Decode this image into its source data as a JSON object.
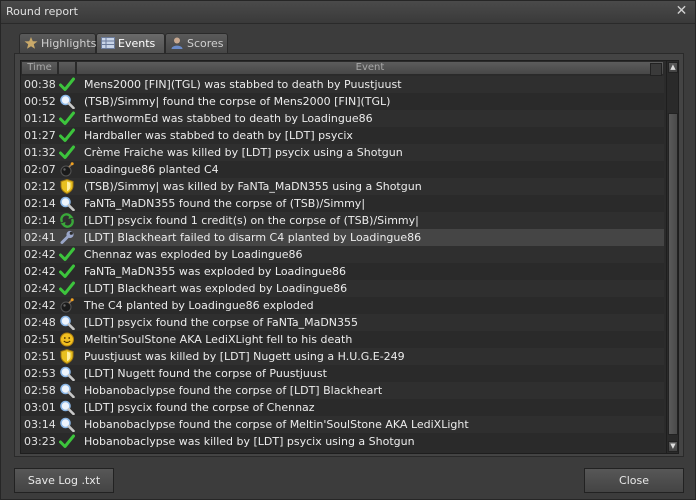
{
  "window": {
    "title": "Round report",
    "close_symbol": "✕"
  },
  "tabs": [
    {
      "label": "Highlights",
      "icon": "star-icon"
    },
    {
      "label": "Events",
      "icon": "table-icon"
    },
    {
      "label": "Scores",
      "icon": "person-icon"
    }
  ],
  "columns": {
    "time": "Time",
    "event": "Event"
  },
  "rows": [
    {
      "time": "00:38",
      "icon": "check",
      "text": "Mens2000 [FIN](TGL) was stabbed to death by Puustjuust"
    },
    {
      "time": "00:52",
      "icon": "magnifier",
      "text": "(TSB)/Simmy| found the corpse of Mens2000 [FIN](TGL)"
    },
    {
      "time": "01:12",
      "icon": "check",
      "text": "EarthwormEd was stabbed to death by Loadingue86"
    },
    {
      "time": "01:27",
      "icon": "check",
      "text": "Hardballer was stabbed to death by [LDT] psycix"
    },
    {
      "time": "01:32",
      "icon": "check",
      "text": "Crème Fraiche was killed by [LDT] psycix using a Shotgun"
    },
    {
      "time": "02:07",
      "icon": "bomb",
      "text": "Loadingue86 planted C4"
    },
    {
      "time": "02:12",
      "icon": "shield",
      "text": "(TSB)/Simmy| was killed by FaNTa_MaDN355 using a Shotgun"
    },
    {
      "time": "02:14",
      "icon": "magnifier",
      "text": "FaNTa_MaDN355 found the corpse of (TSB)/Simmy|"
    },
    {
      "time": "02:14",
      "icon": "recycle",
      "text": "[LDT] psycix found 1 credit(s) on the corpse of (TSB)/Simmy|"
    },
    {
      "time": "02:41",
      "icon": "wrench",
      "text": "[LDT] Blackheart failed to disarm C4 planted by Loadingue86"
    },
    {
      "time": "02:42",
      "icon": "check",
      "text": "Chennaz was exploded by Loadingue86"
    },
    {
      "time": "02:42",
      "icon": "check",
      "text": "FaNTa_MaDN355 was exploded by Loadingue86"
    },
    {
      "time": "02:42",
      "icon": "check",
      "text": "[LDT] Blackheart was exploded by Loadingue86"
    },
    {
      "time": "02:42",
      "icon": "bomb",
      "text": "The C4 planted by Loadingue86 exploded"
    },
    {
      "time": "02:48",
      "icon": "magnifier",
      "text": "[LDT] psycix found the corpse of FaNTa_MaDN355"
    },
    {
      "time": "02:51",
      "icon": "smiley",
      "text": "Meltin'SoulStone AKA LediXLight fell to his death"
    },
    {
      "time": "02:51",
      "icon": "shield",
      "text": "Puustjuust was killed by [LDT] Nugett using a H.U.G.E-249"
    },
    {
      "time": "02:53",
      "icon": "magnifier",
      "text": "[LDT] Nugett found the corpse of Puustjuust"
    },
    {
      "time": "02:58",
      "icon": "magnifier",
      "text": "Hobanobaclypse found the corpse of [LDT] Blackheart"
    },
    {
      "time": "03:01",
      "icon": "magnifier",
      "text": "[LDT] psycix found the corpse of Chennaz"
    },
    {
      "time": "03:14",
      "icon": "magnifier",
      "text": "Hobanobaclypse found the corpse of Meltin'SoulStone AKA LediXLight"
    },
    {
      "time": "03:23",
      "icon": "check",
      "text": "Hobanobaclypse was killed by [LDT] psycix using a Shotgun"
    }
  ],
  "highlighted_row": 9,
  "buttons": {
    "save": "Save Log .txt",
    "close": "Close"
  },
  "colors": {
    "check": "#3cc43c",
    "magnifier": "#8ab6e6",
    "shield": "#e8c020",
    "bomb": "#222222",
    "recycle": "#3aa83a",
    "wrench": "#9aa6c8",
    "smiley": "#f2c020"
  }
}
